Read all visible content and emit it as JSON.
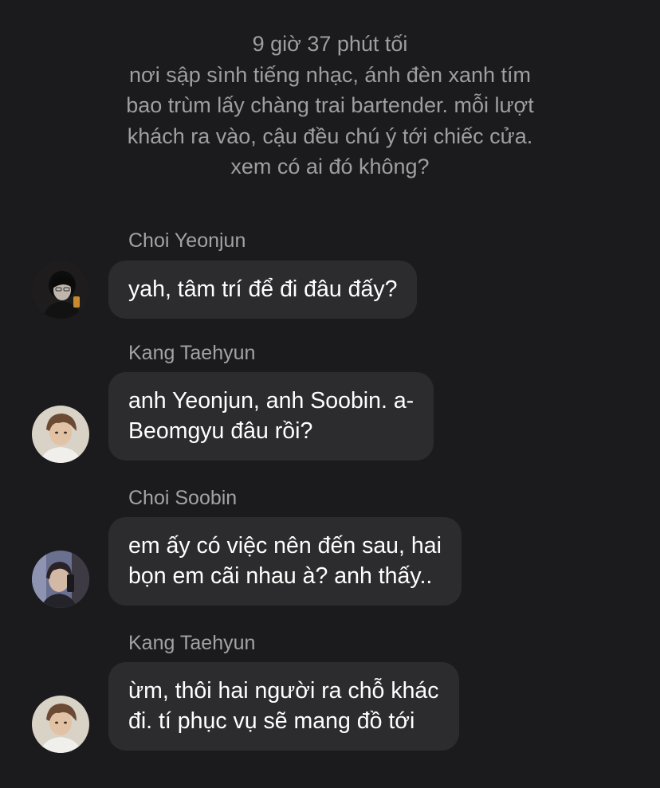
{
  "system_note": {
    "lines": [
      "9 giờ 37 phút tối",
      "nơi sập sình tiếng nhạc, ánh đèn xanh tím",
      "bao trùm lấy chàng trai bartender. mỗi lượt",
      "khách ra vào, cậu đều chú ý tới chiếc cửa.",
      "xem có ai đó không?"
    ]
  },
  "messages": [
    {
      "sender": "Choi Yeonjun",
      "lines": [
        "yah, tâm trí để đi đâu đấy?"
      ],
      "avatar_icon": "dark-portrait-avatar"
    },
    {
      "sender": "Kang Taehyun",
      "lines": [
        "anh Yeonjun, anh Soobin. a-",
        "Beomgyu đâu rồi?"
      ],
      "avatar_icon": "brown-hair-portrait-avatar"
    },
    {
      "sender": "Choi Soobin",
      "lines": [
        "em ấy có việc nên đến sau, hai",
        "bọn em cãi nhau à? anh thấy.."
      ],
      "avatar_icon": "selfie-portrait-avatar"
    },
    {
      "sender": "Kang Taehyun",
      "lines": [
        "ừm, thôi hai người ra chỗ khác",
        "đi. tí phục vụ sẽ mang đồ tới"
      ],
      "avatar_icon": "brown-hair-portrait-avatar"
    }
  ],
  "colors": {
    "background": "#1b1b1d",
    "bubble": "#2c2c2e",
    "text": "#ffffff",
    "meta_text": "#9e9ea3"
  }
}
